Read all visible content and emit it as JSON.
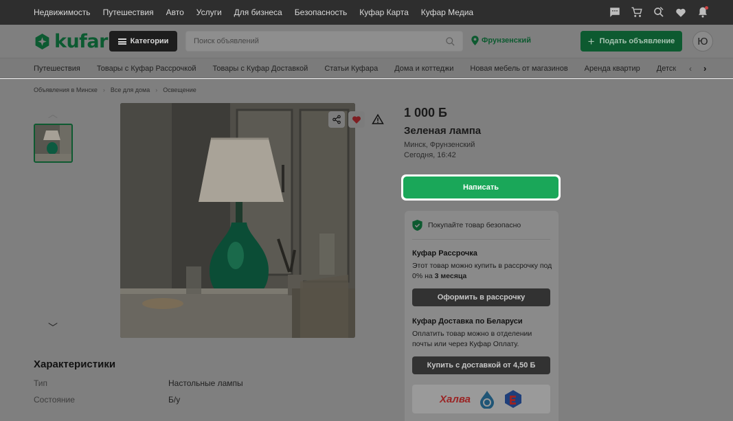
{
  "topbar": {
    "links": [
      "Недвижимость",
      "Путешествия",
      "Авто",
      "Услуги",
      "Для бизнеса",
      "Безопасность",
      "Куфар Карта",
      "Куфар Медиа"
    ],
    "icons": [
      "chat-icon",
      "cart-icon",
      "saved-search-icon",
      "heart-icon",
      "bell-icon"
    ]
  },
  "header": {
    "logo": "kufar",
    "categories_label": "Категории",
    "search_placeholder": "Поиск объявлений",
    "location": "Фрунзенский",
    "post_label": "Подать объявление",
    "avatar_initial": "Ю"
  },
  "category_strip": {
    "items": [
      "Путешествия",
      "Товары с Куфар Рассрочкой",
      "Товары с Куфар Доставкой",
      "Статьи Куфара",
      "Дома и коттеджи",
      "Новая мебель от магазинов",
      "Аренда квартир",
      "Детск"
    ]
  },
  "breadcrumb": [
    "Объявления в Минске",
    "Все для дома",
    "Освещение"
  ],
  "listing": {
    "price": "1 000 Б",
    "title": "Зеленая лампа",
    "location": "Минск, Фрунзенский",
    "posted": "Сегодня, 16:42",
    "write_label": "Написать"
  },
  "panel": {
    "safe_text": "Покупайте товар безопасно",
    "installment": {
      "title": "Куфар Рассрочка",
      "text": "Этот товар можно купить в рассрочку под 0% на",
      "term": "3 месяца",
      "button": "Оформить в рассрочку"
    },
    "delivery": {
      "title": "Куфар Доставка по Беларуси",
      "text": "Оплатить товар можно в отделении почты или через Куфар Оплату.",
      "button": "Купить с доставкой от 4,50 Б"
    },
    "partner_halva": "Халва"
  },
  "characteristics": {
    "title": "Характеристики",
    "rows": [
      {
        "key": "Тип",
        "value": "Настольные лампы"
      },
      {
        "key": "Состояние",
        "value": "Б/у"
      }
    ]
  },
  "colors": {
    "brand_green": "#1aa759",
    "overlay_gray": "#7f7f7f"
  }
}
